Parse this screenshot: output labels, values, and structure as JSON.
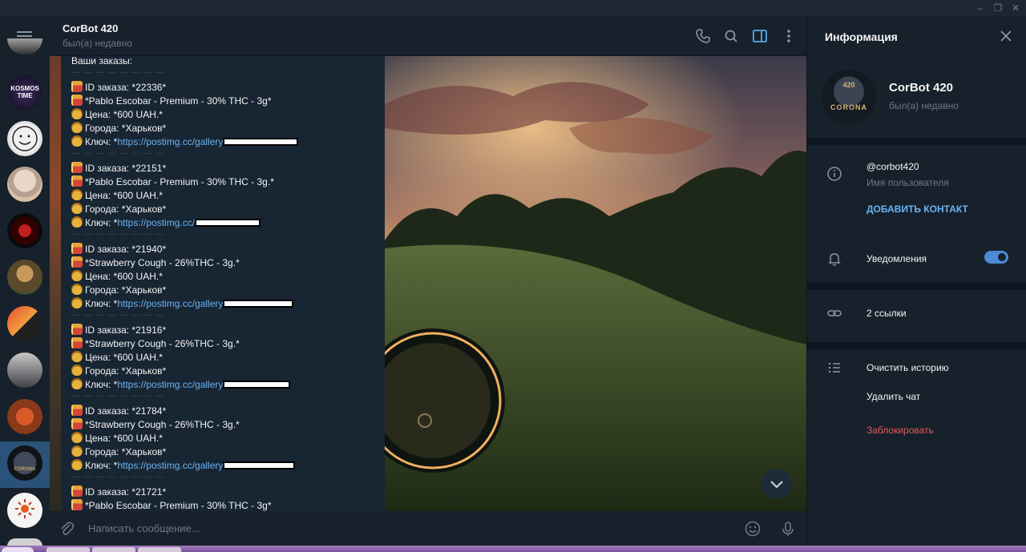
{
  "chat": {
    "title": "CorBot 420",
    "status": "был(а) недавно"
  },
  "messages": {
    "header": "Ваши заказы:",
    "separator": "— — — — — — — —",
    "orders": [
      {
        "id": "ID заказа: *22336*",
        "product": "*Pablo Escobar - Premium - 30% THC - 3g*",
        "price": "Цена: *600 UAH.*",
        "city": "Города: *Харьков*",
        "key_prefix": "Ключ: *",
        "key_link": "https://postimg.cc/gallery"
      },
      {
        "id": "ID заказа: *22151*",
        "product": "*Pablo Escobar - Premium - 30% THC - 3g.*",
        "price": "Цена: *600 UAH.*",
        "city": "Города: *Харьков*",
        "key_prefix": "Ключ: *",
        "key_link": "https://postimg.cc/"
      },
      {
        "id": "ID заказа: *21940*",
        "product": "*Strawberry Cough - 26%THC - 3g.*",
        "price": "Цена: *600 UAH.*",
        "city": "Города: *Харьков*",
        "key_prefix": "Ключ: *",
        "key_link": "https://postimg.cc/gallery"
      },
      {
        "id": "ID заказа: *21916*",
        "product": "*Strawberry Cough - 26%THC - 3g.*",
        "price": "Цена: *600 UAH.*",
        "city": "Города: *Харьков*",
        "key_prefix": "Ключ: *",
        "key_link": "https://postimg.cc/gallery"
      },
      {
        "id": "ID заказа: *21784*",
        "product": "*Strawberry Cough - 26%THC - 3g.*",
        "price": "Цена: *600 UAH.*",
        "city": "Города: *Харьков*",
        "key_prefix": "Ключ: *",
        "key_link": "https://postimg.cc/gallery"
      },
      {
        "id": "ID заказа: *21721*",
        "product": "*Pablo Escobar - Premium - 30% THC - 3g*"
      }
    ]
  },
  "composer": {
    "placeholder": "Написать сообщение..."
  },
  "info": {
    "title": "Информация",
    "name": "CorBot 420",
    "status": "был(а) недавно",
    "avatar_text": "CORONA",
    "avatar_num": "420",
    "username": "@corbot420",
    "username_caption": "Имя пользователя",
    "add_contact": "ДОБАВИТЬ КОНТАКТ",
    "notifications": "Уведомления",
    "links": "2 ссылки",
    "clear_history": "Очистить историю",
    "delete_chat": "Удалить чат",
    "block": "Заблокировать"
  },
  "sidebar": {
    "kosmos_line1": "KOSMOS",
    "kosmos_line2": "TIME"
  },
  "colors": {
    "accent": "#6ab3f3",
    "danger": "#e05a5a",
    "bg": "#17212b",
    "selected": "#2b5278"
  }
}
